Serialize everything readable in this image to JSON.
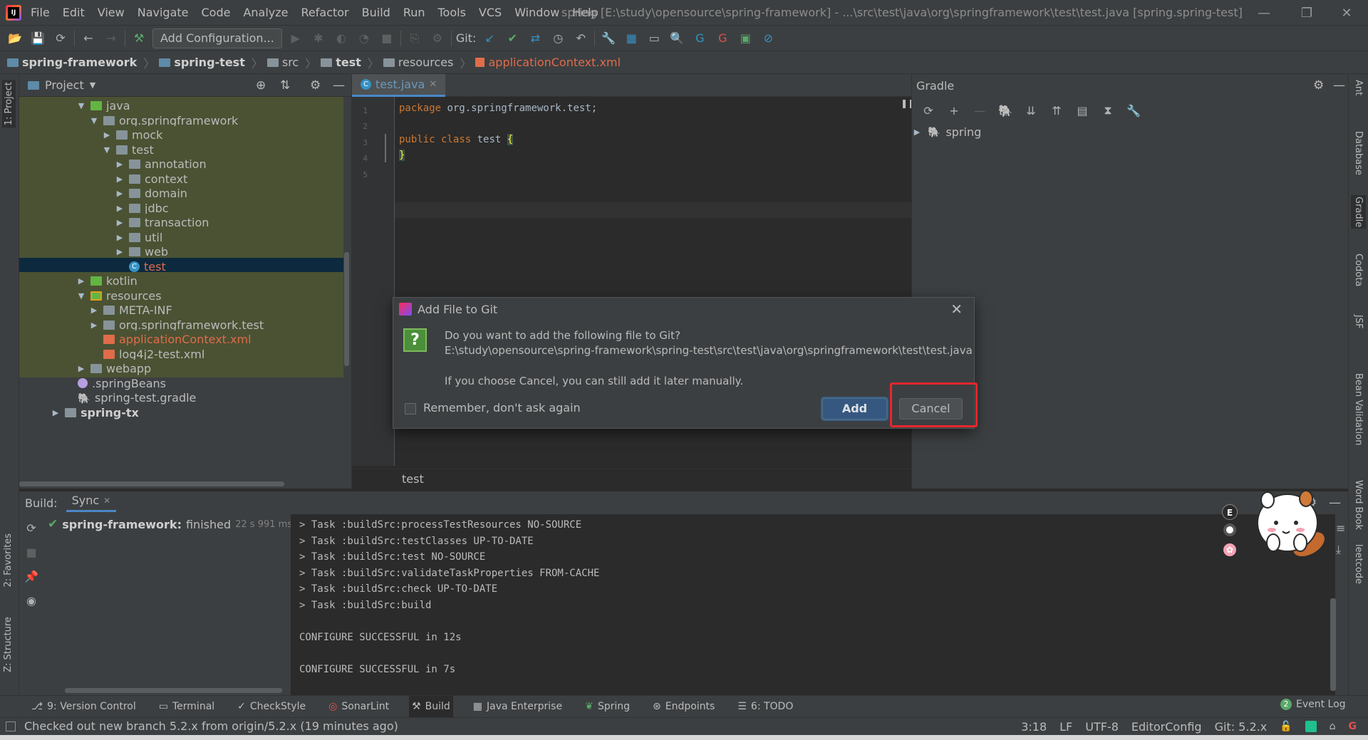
{
  "window": {
    "title": "spring [E:\\study\\opensource\\spring-framework] - ...\\src\\test\\java\\org\\springframework\\test\\test.java [spring.spring-test]"
  },
  "menu": [
    "File",
    "Edit",
    "View",
    "Navigate",
    "Code",
    "Analyze",
    "Refactor",
    "Build",
    "Run",
    "Tools",
    "VCS",
    "Window",
    "Help"
  ],
  "toolbar": {
    "add_configuration": "Add Configuration...",
    "git_label": "Git:"
  },
  "breadcrumb": [
    "spring-framework",
    "spring-test",
    "src",
    "test",
    "resources",
    "applicationContext.xml"
  ],
  "left_stripe": {
    "project": "1: Project",
    "favorites": "2: Favorites",
    "structure": "Z: Structure"
  },
  "project_panel": {
    "title": "Project",
    "tree": [
      {
        "label": "java",
        "indent": 1,
        "arrow": "▼",
        "icon": "green",
        "state": "hl"
      },
      {
        "label": "org.springframework",
        "indent": 2,
        "arrow": "▼",
        "icon": "folder",
        "state": "hl"
      },
      {
        "label": "mock",
        "indent": 3,
        "arrow": "▶",
        "icon": "folder",
        "state": "hl"
      },
      {
        "label": "test",
        "indent": 3,
        "arrow": "▼",
        "icon": "folder",
        "state": "hl"
      },
      {
        "label": "annotation",
        "indent": 4,
        "arrow": "▶",
        "icon": "folder",
        "state": "hl"
      },
      {
        "label": "context",
        "indent": 4,
        "arrow": "▶",
        "icon": "folder",
        "state": "hl"
      },
      {
        "label": "domain",
        "indent": 4,
        "arrow": "▶",
        "icon": "folder",
        "state": "hl"
      },
      {
        "label": "jdbc",
        "indent": 4,
        "arrow": "▶",
        "icon": "folder",
        "state": "hl"
      },
      {
        "label": "transaction",
        "indent": 4,
        "arrow": "▶",
        "icon": "folder",
        "state": "hl"
      },
      {
        "label": "util",
        "indent": 4,
        "arrow": "▶",
        "icon": "folder",
        "state": "hl"
      },
      {
        "label": "web",
        "indent": 4,
        "arrow": "▶",
        "icon": "folder",
        "state": "hl"
      },
      {
        "label": "test",
        "indent": 4,
        "arrow": "",
        "icon": "cls",
        "state": "sel"
      },
      {
        "label": "kotlin",
        "indent": 1,
        "arrow": "▶",
        "icon": "green",
        "state": "hl"
      },
      {
        "label": "resources",
        "indent": 1,
        "arrow": "▼",
        "icon": "res",
        "state": "hl"
      },
      {
        "label": "META-INF",
        "indent": 2,
        "arrow": "▶",
        "icon": "folder",
        "state": "hl"
      },
      {
        "label": "org.springframework.test",
        "indent": 2,
        "arrow": "▶",
        "icon": "folder",
        "state": "hl"
      },
      {
        "label": "applicationContext.xml",
        "indent": 2,
        "arrow": "",
        "icon": "xml",
        "state": "hl",
        "red": true
      },
      {
        "label": "log4j2-test.xml",
        "indent": 2,
        "arrow": "",
        "icon": "xml",
        "state": "hl"
      },
      {
        "label": "webapp",
        "indent": 1,
        "arrow": "▶",
        "icon": "folder",
        "state": "hl"
      },
      {
        "label": ".springBeans",
        "indent": 0,
        "arrow": "",
        "icon": "beans",
        "state": ""
      },
      {
        "label": "spring-test.gradle",
        "indent": 0,
        "arrow": "",
        "icon": "gradle",
        "state": ""
      },
      {
        "label": "spring-tx",
        "indent": -1,
        "arrow": "▶",
        "icon": "folder",
        "state": "",
        "bold": true
      }
    ]
  },
  "editor": {
    "tab": "test.java",
    "lines": [
      "1",
      "2",
      "3",
      "4",
      "5"
    ],
    "code": {
      "l1_kw": "package",
      "l1_rest": " org.springframework.test;",
      "l3_kw": "public class",
      "l3_rest": " test ",
      "l3_brace": "{",
      "l4_brace": "}"
    },
    "footer": "test"
  },
  "gradle": {
    "title": "Gradle",
    "root": "spring"
  },
  "right_stripe": [
    "Ant",
    "Database",
    "Gradle",
    "Codota",
    "JSF",
    "Bean Validation",
    "Word Book",
    "leetcode"
  ],
  "build": {
    "label": "Build:",
    "tab": "Sync",
    "status_name": "spring-framework:",
    "status_text": "finished",
    "status_time": "22 s 991 ms",
    "log": [
      "> Task :buildSrc:processTestResources NO-SOURCE",
      "> Task :buildSrc:testClasses UP-TO-DATE",
      "> Task :buildSrc:test NO-SOURCE",
      "> Task :buildSrc:validateTaskProperties FROM-CACHE",
      "> Task :buildSrc:check UP-TO-DATE",
      "> Task :buildSrc:build",
      "",
      "CONFIGURE SUCCESSFUL in 12s",
      "",
      "CONFIGURE SUCCESSFUL in 7s"
    ]
  },
  "bottom_tabs": [
    "9: Version Control",
    "Terminal",
    "CheckStyle",
    "SonarLint",
    "Build",
    "Java Enterprise",
    "Spring",
    "Endpoints",
    "6: TODO"
  ],
  "event_log": {
    "count": "2",
    "label": "Event Log"
  },
  "status": {
    "message": "Checked out new branch 5.2.x from origin/5.2.x (19 minutes ago)",
    "position": "3:18",
    "line_sep": "LF",
    "encoding": "UTF-8",
    "editorconfig": "EditorConfig",
    "git": "Git: 5.2.x"
  },
  "dialog": {
    "title": "Add File to Git",
    "question": "Do you want to add the following file to Git?",
    "path": "E:\\study\\opensource\\spring-framework\\spring-test\\src\\test\\java\\org\\springframework\\test\\test.java",
    "hint": "If you choose Cancel, you can still add it later manually.",
    "remember": "Remember, don't ask again",
    "add": "Add",
    "cancel": "Cancel"
  },
  "mascot": {
    "badge": "E"
  },
  "colors": {
    "accent": "#4a88c7",
    "highlight": "#e8262f",
    "selection": "#0d293e",
    "primary_button": "#365880"
  }
}
